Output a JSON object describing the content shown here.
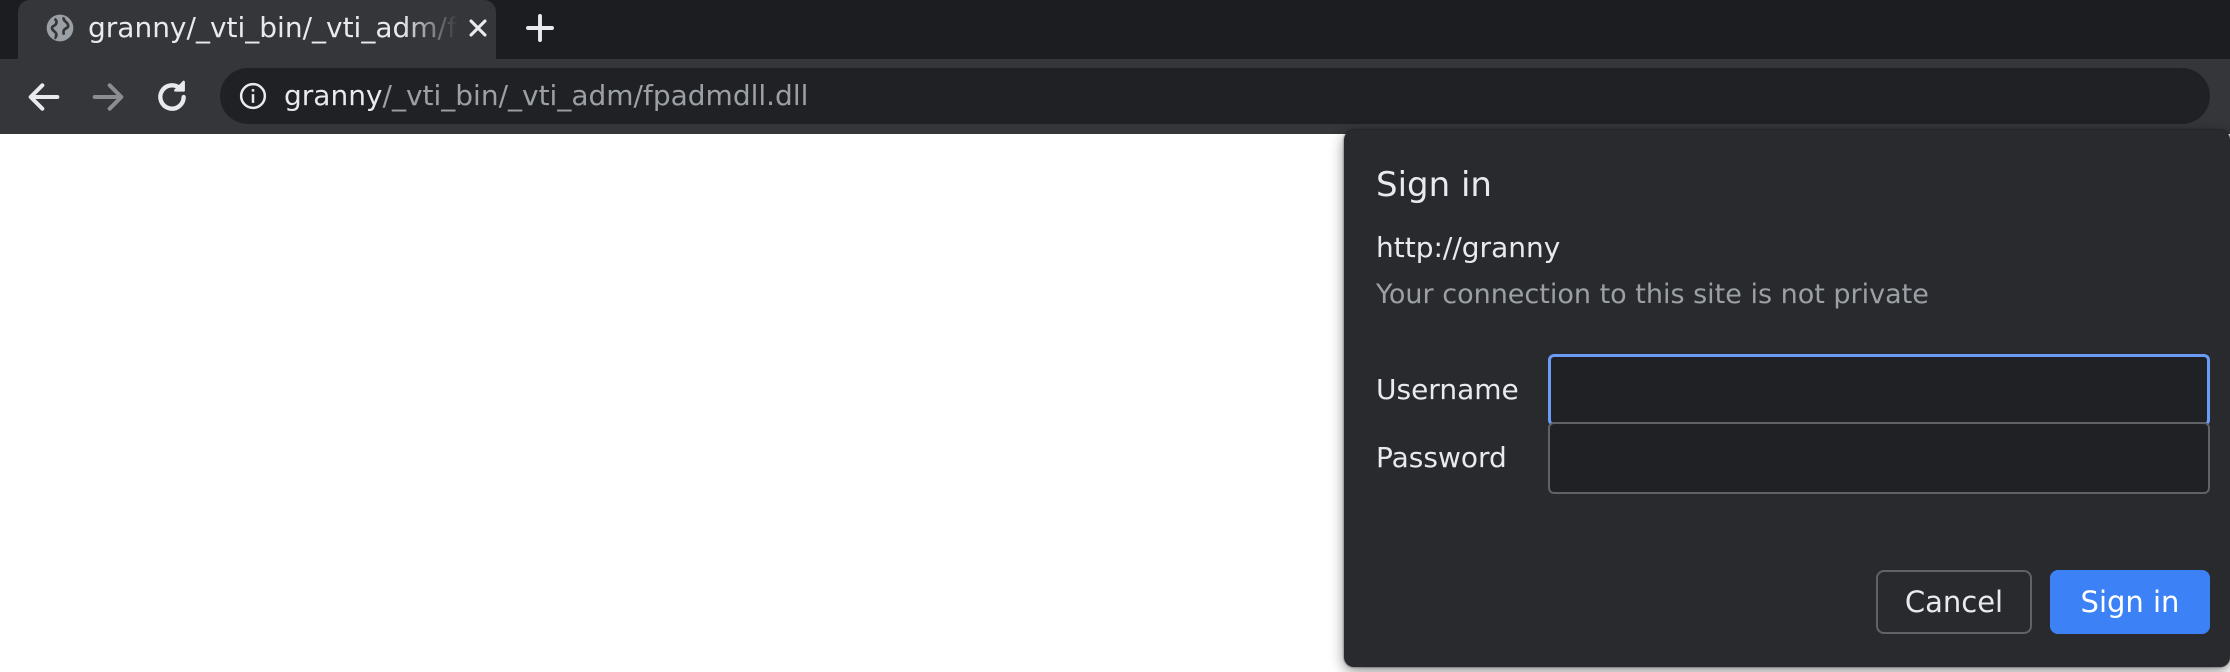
{
  "tab": {
    "favicon": "globe-icon",
    "title": "granny/_vti_bin/_vti_adm/fpadmdll.dll",
    "close_icon": "close-icon"
  },
  "newtab_icon": "plus-icon",
  "toolbar": {
    "back_icon": "arrow-left-icon",
    "forward_icon": "arrow-right-icon",
    "reload_icon": "reload-icon",
    "site_info_icon": "info-icon",
    "url_host": "granny",
    "url_path": "/_vti_bin/_vti_adm/fpadmdll.dll"
  },
  "background": {
    "partial_link": "fpadmdll.dll"
  },
  "dialog": {
    "title": "Sign in",
    "origin": "http://granny",
    "warning": "Your connection to this site is not private",
    "username_label": "Username",
    "username_value": "",
    "password_label": "Password",
    "password_value": "",
    "cancel_label": "Cancel",
    "signin_label": "Sign in"
  },
  "colors": {
    "accent": "#3c82f6",
    "focus_ring": "#6a9cf5",
    "dialog_bg": "#292a2d",
    "tabstrip_bg": "#1c1d21",
    "toolbar_bg": "#35363a"
  }
}
